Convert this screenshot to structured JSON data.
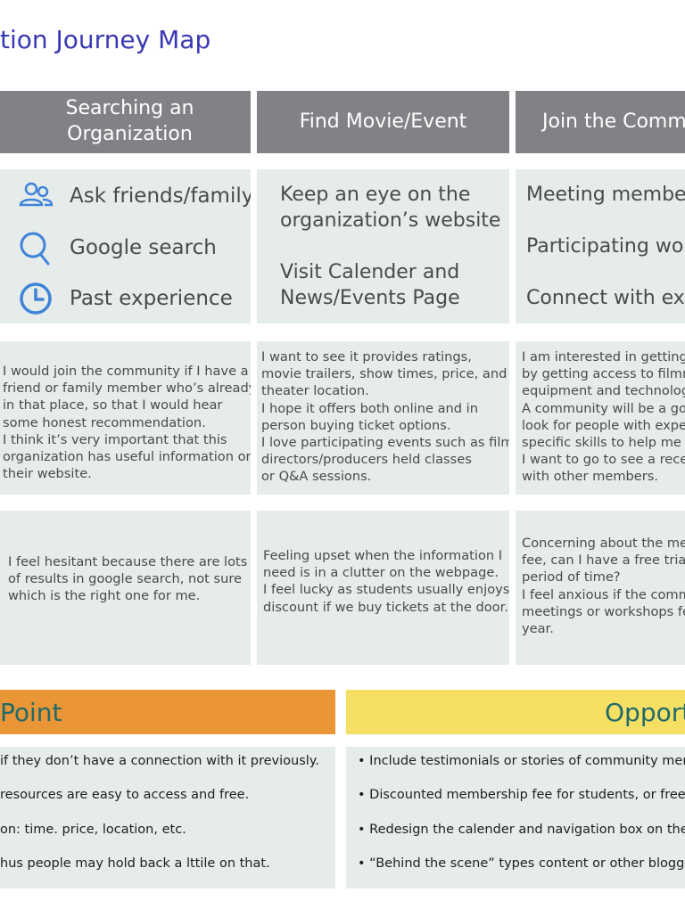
{
  "title": "tion Journey Map",
  "stages": [
    "Searching an\nOrganization",
    "Find Movie/Event",
    "Join the Comm"
  ],
  "touchpoints": {
    "col1": [
      {
        "icon": "people-icon",
        "label": "Ask friends/family"
      },
      {
        "icon": "search-icon",
        "label": "Google search"
      },
      {
        "icon": "clock-icon",
        "label": "Past experience"
      }
    ],
    "col2": [
      "Keep an eye on the",
      "organization’s website",
      "",
      "Visit Calender and",
      "News/Events Page"
    ],
    "col3": [
      "Meeting member",
      "",
      "Participating wor",
      "",
      "Connect with exp"
    ]
  },
  "thinking": {
    "col1": [
      "I would join the community if I have a",
      "friend or family member who’s already",
      "in that place, so that I would hear",
      "some honest recommendation.",
      "I think it’s very important that this",
      "organization has useful information on",
      "their website."
    ],
    "col2": [
      "I want to see it provides ratings,",
      "movie trailers, show times, price, and",
      "theater location.",
      "I hope it offers both online and in",
      "person buying ticket options.",
      "I love participating events such as film",
      "directors/producers held classes",
      "or Q&A sessions."
    ],
    "col3": [
      "I am interested in getting",
      "by getting access to filmm",
      "equipment and technolog",
      "A community will be a goo",
      "look for people with exper",
      "specific skills to help me b",
      "I want to go to see a recen",
      "with other members."
    ]
  },
  "feeling": {
    "col1": [
      "I feel hesitant because there are lots",
      "of results in google search, not sure",
      "which is the right one for me."
    ],
    "col2": [
      "Feeling upset when the information I",
      "need is in a clutter on the webpage.",
      "I feel lucky as students usually enjoys",
      "discount if we buy tickets at the door."
    ],
    "col3": [
      "Concerning about the me",
      "fee, can I have a free trial",
      "period of time?",
      "I feel anxious if the comm",
      "meetings or workshops fe",
      "year."
    ]
  },
  "pain": {
    "heading": "Point",
    "items": [
      "if they don’t have a connection with it previously.",
      "resources are easy to access and free.",
      "on: time. price, location, etc.",
      "hus people may hold back a lttile on that."
    ]
  },
  "opportunity": {
    "heading": "Opport",
    "items": [
      "• Include testimonials or stories of community member",
      "• Discounted membership fee for students, or free trial f",
      "• Redesign the calender and navigation box on the hom",
      "• “Behind the scene” types content or other blogging co"
    ]
  },
  "colors": {
    "header": "#808285",
    "cell": "#e6ecea",
    "pain": "#ea9636",
    "opportunity": "#f5e064",
    "title": "#3a39b4",
    "icon": "#3f83d8"
  }
}
